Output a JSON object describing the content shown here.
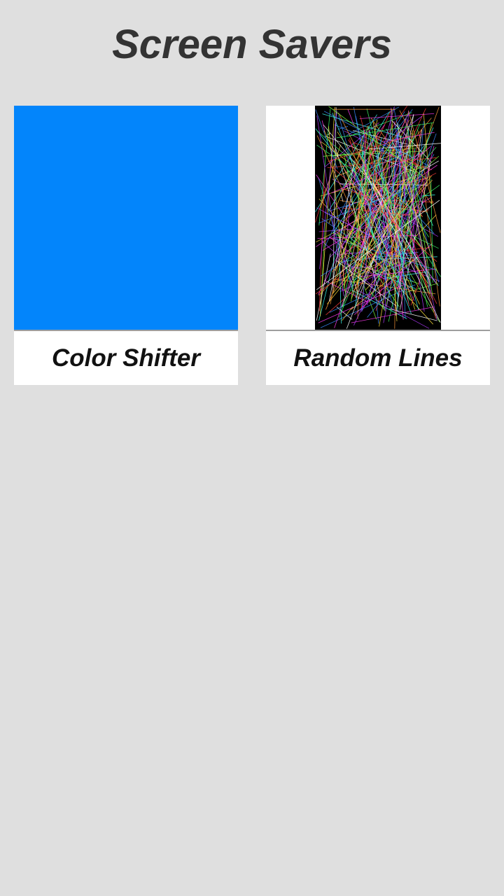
{
  "header": {
    "title": "Screen Savers"
  },
  "savers": [
    {
      "label": "Color Shifter",
      "preview": "solid-color",
      "preview_color": "#0385fb"
    },
    {
      "label": "Random Lines",
      "preview": "random-lines",
      "preview_background": "#000000",
      "line_colors": [
        "#ff3b3b",
        "#3bff6a",
        "#3b8bff",
        "#ffe13b",
        "#ff3bf0",
        "#3bfff2",
        "#ff9a3b",
        "#ffffff",
        "#b23bff",
        "#7dff3b"
      ]
    }
  ]
}
